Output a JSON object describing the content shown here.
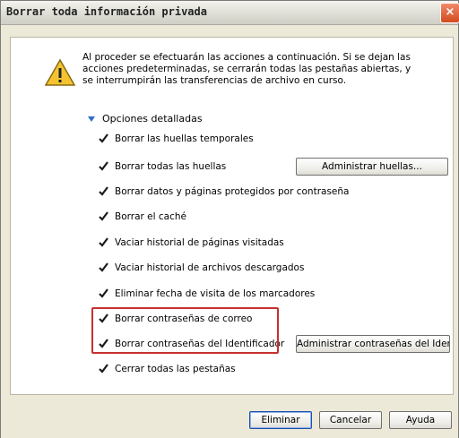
{
  "window": {
    "title": "Borrar toda información privada",
    "close_icon": "×"
  },
  "warning": {
    "icon": "warning-icon",
    "text": "Al proceder se efectuarán las acciones a continuación. Si se dejan las acciones predeterminadas, se cerrarán todas las pestañas abiertas, y se interrumpirán las transferencias de archivo en curso."
  },
  "section": {
    "label": "Opciones detalladas",
    "expanded": true
  },
  "options": [
    {
      "label": "Borrar las huellas temporales",
      "checked": true
    },
    {
      "label": "Borrar todas las huellas",
      "checked": true
    },
    {
      "label": "Borrar datos y páginas protegidos por contraseña",
      "checked": true
    },
    {
      "label": "Borrar el caché",
      "checked": true
    },
    {
      "label": "Vaciar historial de páginas visitadas",
      "checked": true
    },
    {
      "label": "Vaciar historial de archivos descargados",
      "checked": true
    },
    {
      "label": "Eliminar fecha de visita de los marcadores",
      "checked": true
    },
    {
      "label": "Borrar contraseñas de correo",
      "checked": true
    },
    {
      "label": "Borrar contraseñas del Identificador",
      "checked": true
    },
    {
      "label": "Cerrar todas las pestañas",
      "checked": true
    }
  ],
  "side_buttons": {
    "manage_traces": "Administrar huellas...",
    "manage_passwords": "Administrar contraseñas del Identificador"
  },
  "footer": {
    "delete": "Eliminar",
    "cancel": "Cancelar",
    "help": "Ayuda"
  },
  "colors": {
    "highlight": "#c63030",
    "accent": "#2f6fc8"
  }
}
